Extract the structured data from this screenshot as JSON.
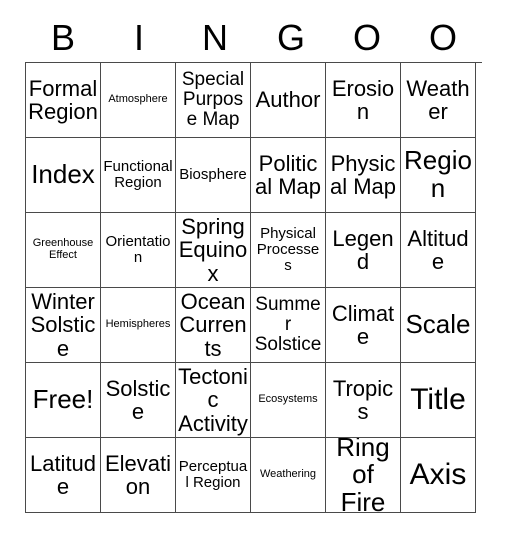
{
  "card": {
    "header_letters": [
      "B",
      "I",
      "N",
      "G",
      "O",
      "O"
    ],
    "columns": 6,
    "rows": 6,
    "colors": {
      "background": "#ffffff",
      "cell_background": "#ffffff",
      "border": "#4a4a4a",
      "text": "#000000"
    },
    "cells": [
      [
        {
          "label": "Formal Region",
          "size": "l"
        },
        {
          "label": "Atmosphere",
          "size": "xs"
        },
        {
          "label": "Special Purpose Map",
          "size": "m"
        },
        {
          "label": "Author",
          "size": "l"
        },
        {
          "label": "Erosion",
          "size": "l"
        },
        {
          "label": "Weather",
          "size": "l"
        }
      ],
      [
        {
          "label": "Index",
          "size": "xl"
        },
        {
          "label": "Functional Region",
          "size": "s"
        },
        {
          "label": "Biosphere",
          "size": "s"
        },
        {
          "label": "Political Map",
          "size": "l"
        },
        {
          "label": "Physical Map",
          "size": "l"
        },
        {
          "label": "Region",
          "size": "xl"
        }
      ],
      [
        {
          "label": "Greenhouse Effect",
          "size": "xs"
        },
        {
          "label": "Orientation",
          "size": "s"
        },
        {
          "label": "Spring Equinox",
          "size": "l"
        },
        {
          "label": "Physical Processes",
          "size": "s"
        },
        {
          "label": "Legend",
          "size": "l"
        },
        {
          "label": "Altitude",
          "size": "l"
        }
      ],
      [
        {
          "label": "Winter Solstice",
          "size": "l"
        },
        {
          "label": "Hemispheres",
          "size": "xs"
        },
        {
          "label": "Ocean Currents",
          "size": "l"
        },
        {
          "label": "Summer Solstice",
          "size": "m"
        },
        {
          "label": "Climate",
          "size": "l"
        },
        {
          "label": "Scale",
          "size": "xl"
        }
      ],
      [
        {
          "label": "Free!",
          "size": "xl"
        },
        {
          "label": "Solstice",
          "size": "l"
        },
        {
          "label": "Tectonic Activity",
          "size": "l"
        },
        {
          "label": "Ecosystems",
          "size": "xs"
        },
        {
          "label": "Tropics",
          "size": "l"
        },
        {
          "label": "Title",
          "size": "xxl"
        }
      ],
      [
        {
          "label": "Latitude",
          "size": "l"
        },
        {
          "label": "Elevation",
          "size": "l"
        },
        {
          "label": "Perceptual Region",
          "size": "s"
        },
        {
          "label": "Weathering",
          "size": "xs"
        },
        {
          "label": "Ring of Fire",
          "size": "xl"
        },
        {
          "label": "Axis",
          "size": "xxl"
        }
      ]
    ]
  }
}
